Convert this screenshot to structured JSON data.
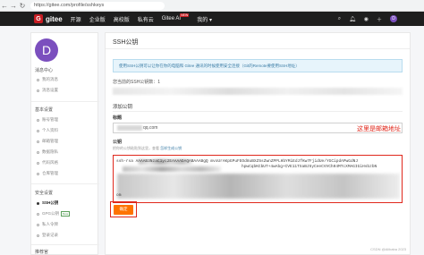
{
  "browser": {
    "back": "←",
    "forward": "→",
    "reload": "↻",
    "url": "https://gitee.com/profile/sshkeys"
  },
  "header": {
    "logo_letter": "G",
    "logo_text": "gitee",
    "nav": [
      "开源",
      "企业版",
      "高校版",
      "私有云"
    ],
    "ai_label": "Gitee AI",
    "ai_badge": "NEW",
    "mine_label": "我的",
    "avatar_letter": "D"
  },
  "sidebar": {
    "avatar_letter": "D",
    "sections": [
      {
        "title": "消息中心",
        "items": [
          "我的消息",
          "消息设置"
        ]
      },
      {
        "title": "基本设置",
        "items": [
          "账号管理",
          "个人资料",
          "邮箱管理",
          "数据隐私",
          "代码风格",
          "仓库管理"
        ]
      },
      {
        "title": "安全设置",
        "items": [
          "SSH公钥",
          "GPG公钥",
          "私人令牌",
          "登录记录"
        ]
      },
      {
        "title": "推荐官",
        "items": []
      }
    ],
    "active_item": "SSH公钥",
    "gpg_badge": "Beta"
  },
  "main": {
    "title": "SSH公钥",
    "info": "使用SSH公钥可以让你在你的电脑和 Gitee 通讯的时候使用安全连接（Git的Remote要使用SSH地址）",
    "added_label": "您当前的SSH公钥数：1",
    "add_section": "添加公钥",
    "title_label": "标题",
    "title_value": "qq.com",
    "annotation": "这里是邮箱地址",
    "key_label": "公钥",
    "key_hint": "把你的公钥粘贴到这里，查看",
    "key_hint_link": "怎样生成公钥",
    "key_prefix": "ssh-rsa AAAAB3NzaC1yc2EAAAADAQABAAABgQ",
    "key_fragment_1": "mvoUrAKpGPuFEOd8uBXZ5sZwnZPPLHbYMiEdJfKw7FjidUe/YGCipdAPwGdNJ",
    "key_fragment_2": "hpwCqbKCbUT+4wAbg+CVE11TXaBJ5yCeeCVVCh04MTcXMAGIGiHsbzbN",
    "key_end": "om",
    "submit": "确定",
    "watermark": "CSDN @Alibaba 2023"
  }
}
